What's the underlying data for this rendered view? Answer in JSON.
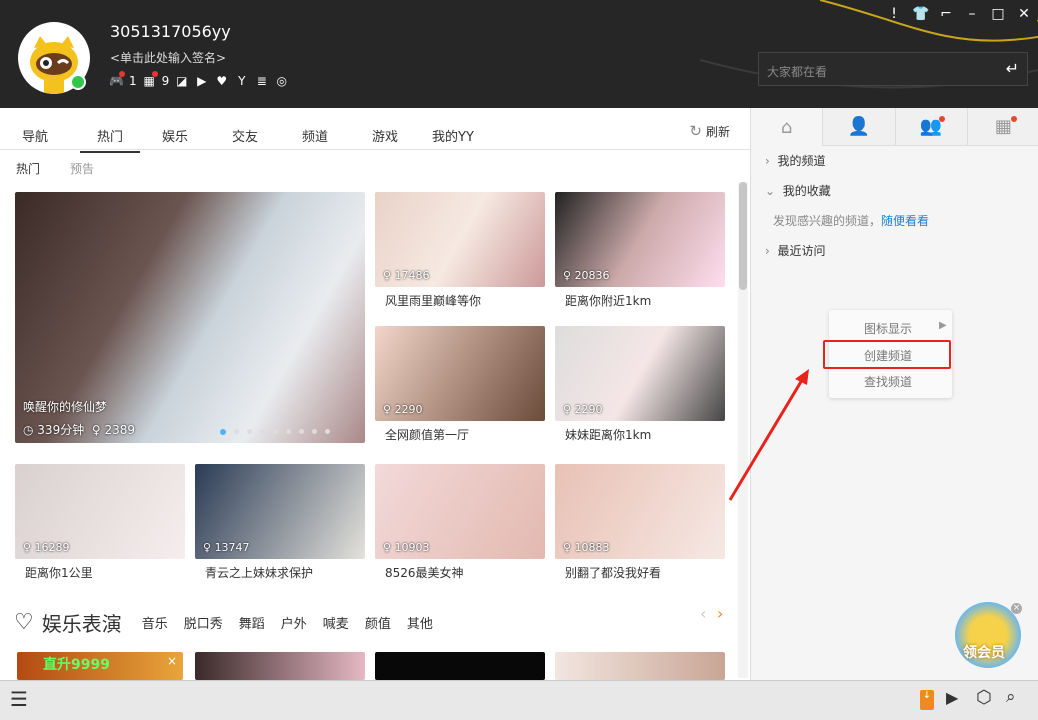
{
  "user": {
    "name": "3051317056yy",
    "signature": "<单击此处输入签名>",
    "badges": [
      {
        "icon": "gamepad-icon",
        "count": "1"
      },
      {
        "icon": "gift-icon",
        "count": "9"
      },
      {
        "icon": "task-icon"
      },
      {
        "icon": "video-icon"
      },
      {
        "icon": "heart-icon"
      },
      {
        "icon": "yo-icon"
      },
      {
        "icon": "coins-icon"
      },
      {
        "icon": "target-icon"
      }
    ]
  },
  "search": {
    "placeholder": "大家都在看"
  },
  "tabs": [
    "导航",
    "热门",
    "娱乐",
    "交友",
    "频道",
    "游戏",
    "我的YY"
  ],
  "refresh": "刷新",
  "subtabs": [
    "热门",
    "预告"
  ],
  "featured": {
    "title": "唤醒你的修仙梦",
    "duration": "339分钟",
    "viewers": "2389",
    "slides": 9
  },
  "cards": [
    {
      "label": "风里雨里巅峰等你",
      "viewers": "17486"
    },
    {
      "label": "距离你附近1km",
      "viewers": "20836"
    },
    {
      "label": "全网颜值第一厅",
      "viewers": "2290"
    },
    {
      "label": "妹妹距离你1km",
      "viewers": "2290"
    },
    {
      "label": "距离你1公里",
      "viewers": "16289"
    },
    {
      "label": "青云之上妹妹求保护",
      "viewers": "13747"
    },
    {
      "label": "8526最美女神",
      "viewers": "10903"
    },
    {
      "label": "别翻了都没我好看",
      "viewers": "10883"
    }
  ],
  "section": {
    "title": "娱乐表演",
    "tags": [
      "音乐",
      "脱口秀",
      "舞蹈",
      "户外",
      "喊麦",
      "颜值",
      "其他"
    ],
    "ad": "直升9999"
  },
  "right": {
    "tree": [
      {
        "label": "我的频道",
        "expanded": false
      },
      {
        "label": "我的收藏",
        "expanded": true
      },
      {
        "label": "最近访问",
        "expanded": false
      }
    ],
    "hint": "发现感兴趣的频道，",
    "hint_link": "随便看看",
    "promo": "领会员"
  },
  "context_menu": [
    "图标显示",
    "创建频道",
    "查找频道"
  ],
  "colors": {
    "header": "#262626",
    "accent": "#1e7fd6",
    "highlight": "#e8231b",
    "online": "#2ec84a"
  }
}
